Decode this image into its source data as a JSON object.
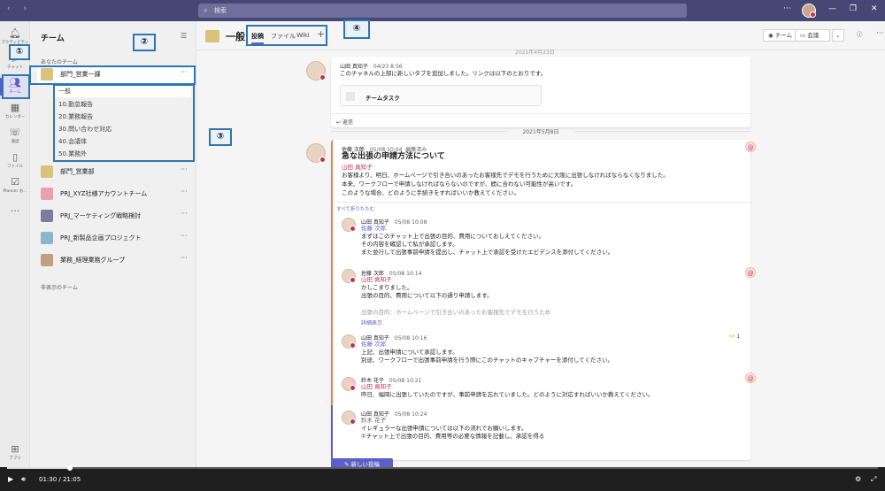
{
  "topbar": {
    "search_placeholder": "検索"
  },
  "rail": [
    {
      "label": "アクティビティ",
      "icon": "bell-icon"
    },
    {
      "label": "チャット",
      "icon": "chat-icon"
    },
    {
      "label": "チーム",
      "icon": "teams-icon",
      "active": true
    },
    {
      "label": "カレンダー",
      "icon": "calendar-icon"
    },
    {
      "label": "通話",
      "icon": "phone-icon"
    },
    {
      "label": "ファイル",
      "icon": "file-icon"
    },
    {
      "label": "Planner お...",
      "icon": "planner-icon"
    },
    {
      "label": "...",
      "icon": "more-icon"
    },
    {
      "label": "アプリ",
      "icon": "apps-icon"
    }
  ],
  "teams_panel": {
    "title": "チーム",
    "your_teams": "あなたのチーム",
    "hidden_teams": "非表示のチーム",
    "join_label": "チームに参加、またはチームを作成",
    "teams": [
      {
        "name": "部門_営業一課",
        "color": "#d9c27a"
      },
      {
        "name": "部門_営業部",
        "color": "#d9c27a"
      },
      {
        "name": "PRJ_XYZ社様アカウントチーム",
        "color": "#e8a0b0"
      },
      {
        "name": "PRJ_マーケティング戦略検討",
        "color": "#7c7c9c"
      },
      {
        "name": "PRJ_新製品企画プロジェクト",
        "color": "#8ab6c9"
      },
      {
        "name": "業務_経理業務グループ",
        "color": "#c0a080"
      }
    ],
    "channels": [
      "一般",
      "10.勤怠報告",
      "20.業務報告",
      "30.問い合わせ対応",
      "40.会議体",
      "50.業務外"
    ]
  },
  "channel_header": {
    "name": "一般",
    "tabs": [
      "投稿",
      "ファイル",
      "Wiki"
    ],
    "team_btn": "チーム",
    "meet_btn": "会議"
  },
  "messages": {
    "msg1": {
      "author": "山田 真知子",
      "time": "04/23 8:56",
      "text": "このチャネルの上部に新しいタブを追加しました。リンクは以下のとおりです。",
      "card_title": "チームタスク",
      "reply": "返信"
    },
    "date_top": "2021年4月23日",
    "date_sep": "2021年5月8日",
    "thread": {
      "author": "佐藤 次郎",
      "time": "05/08 10:04",
      "edited": "編集済み",
      "title": "急な出張の申請方法について",
      "mention": "山田 真知子",
      "lines": [
        "お客様より、明日、ホームページで引き合いのあったお客様先でデモを行うために大阪に出張しなければならなくなりました。",
        "本来、ワークフローで申請しなければならないのですが、間に合わない可能性が高いです。",
        "このような場合、どのように手続きをすればいいか教えてください。"
      ],
      "collapse": "すべて折りたたむ"
    },
    "replies": [
      {
        "author": "山田 真知子",
        "time": "05/08 10:08",
        "mention": "佐藤 次郎",
        "lines": [
          "まずはこのチャット上で出張の目的、費用についておしえてください。",
          "その内容を確認して私が承認します。",
          "また並行して出張事前申請を提出し、チャット上で承認を受けたエビデンスを添付してください。"
        ]
      },
      {
        "author": "佐藤 次郎",
        "time": "05/08 10:14",
        "mention": "山田 真知子",
        "lines": [
          "かしこまりました。",
          "出張の目的、費用について以下の通り申請します。",
          "",
          "出張の目的：ホームページで引き合いのあったお客様先でデモを行うため"
        ],
        "more": "詳細表示"
      },
      {
        "author": "山田 真知子",
        "time": "05/08 10:16",
        "mention": "佐藤 次郎",
        "lines": [
          "上記、出張申請について承認します。",
          "別途、ワークフローで出張事前申請を行う際にこのチャットのキャプチャーを添付してください。"
        ],
        "reaction": "1"
      },
      {
        "author": "鈴木 花子",
        "time": "05/08 10:21",
        "mention": "山田 真知子",
        "lines": [
          "昨日、福岡に出張していたのですが、事前申請を忘れていました。どのように対応すればいいか教えてください。"
        ]
      },
      {
        "author": "山田 真知子",
        "time": "05/08 10:24",
        "mention": "鈴木 花子",
        "lines": [
          "イレギュラーな出張申請については以下の流れでお願いします。",
          "①チャット上で出張の目的、費用等の必要な情報を記載し、承認を得る"
        ]
      }
    ]
  },
  "new_post": "新しい投稿",
  "video": {
    "time": "01:30 / 21:05",
    "progress": 0.072
  },
  "callouts": [
    "①",
    "②",
    "③",
    "④"
  ],
  "colors": {
    "brand": "#464775",
    "accent": "#5b5fc7",
    "mention": "#c4314b",
    "callout": "#2e75b6"
  }
}
